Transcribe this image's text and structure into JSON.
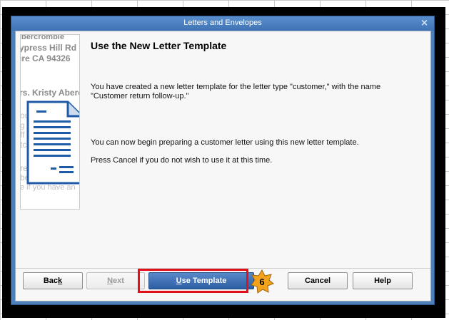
{
  "window": {
    "title": "Letters and Envelopes",
    "close_glyph": "×"
  },
  "illustration": {
    "lines": [
      "ıbercrombie",
      "ypress Hill Rd",
      "ıre CA 94326",
      "rs. Kristy Aberc"
    ],
    "faint_lines": [
      "ou",
      "g",
      "ff",
      "tc",
      "re",
      "be",
      "e if you have an"
    ]
  },
  "content": {
    "heading": "Use the New Letter Template",
    "paragraph1": "You have created a new letter template for the letter type \"customer,\" with the name \"Customer return follow-up.\"",
    "paragraph2": "You can now begin preparing a customer letter using this new letter template.",
    "paragraph3": "Press Cancel if you do not wish to use it at this time."
  },
  "buttons": {
    "back": {
      "pre": "Bac",
      "accel": "k",
      "post": ""
    },
    "next": {
      "pre": "",
      "accel": "N",
      "post": "ext"
    },
    "use_template": {
      "pre": "",
      "accel": "U",
      "post": "se Template"
    },
    "cancel": "Cancel",
    "help": "Help"
  },
  "annotation": {
    "step_number": "6",
    "highlight_color": "#e0111b",
    "badge_color": "#f3a21c"
  },
  "icons": [
    "document-icon",
    "close-icon",
    "step-star-icon"
  ]
}
